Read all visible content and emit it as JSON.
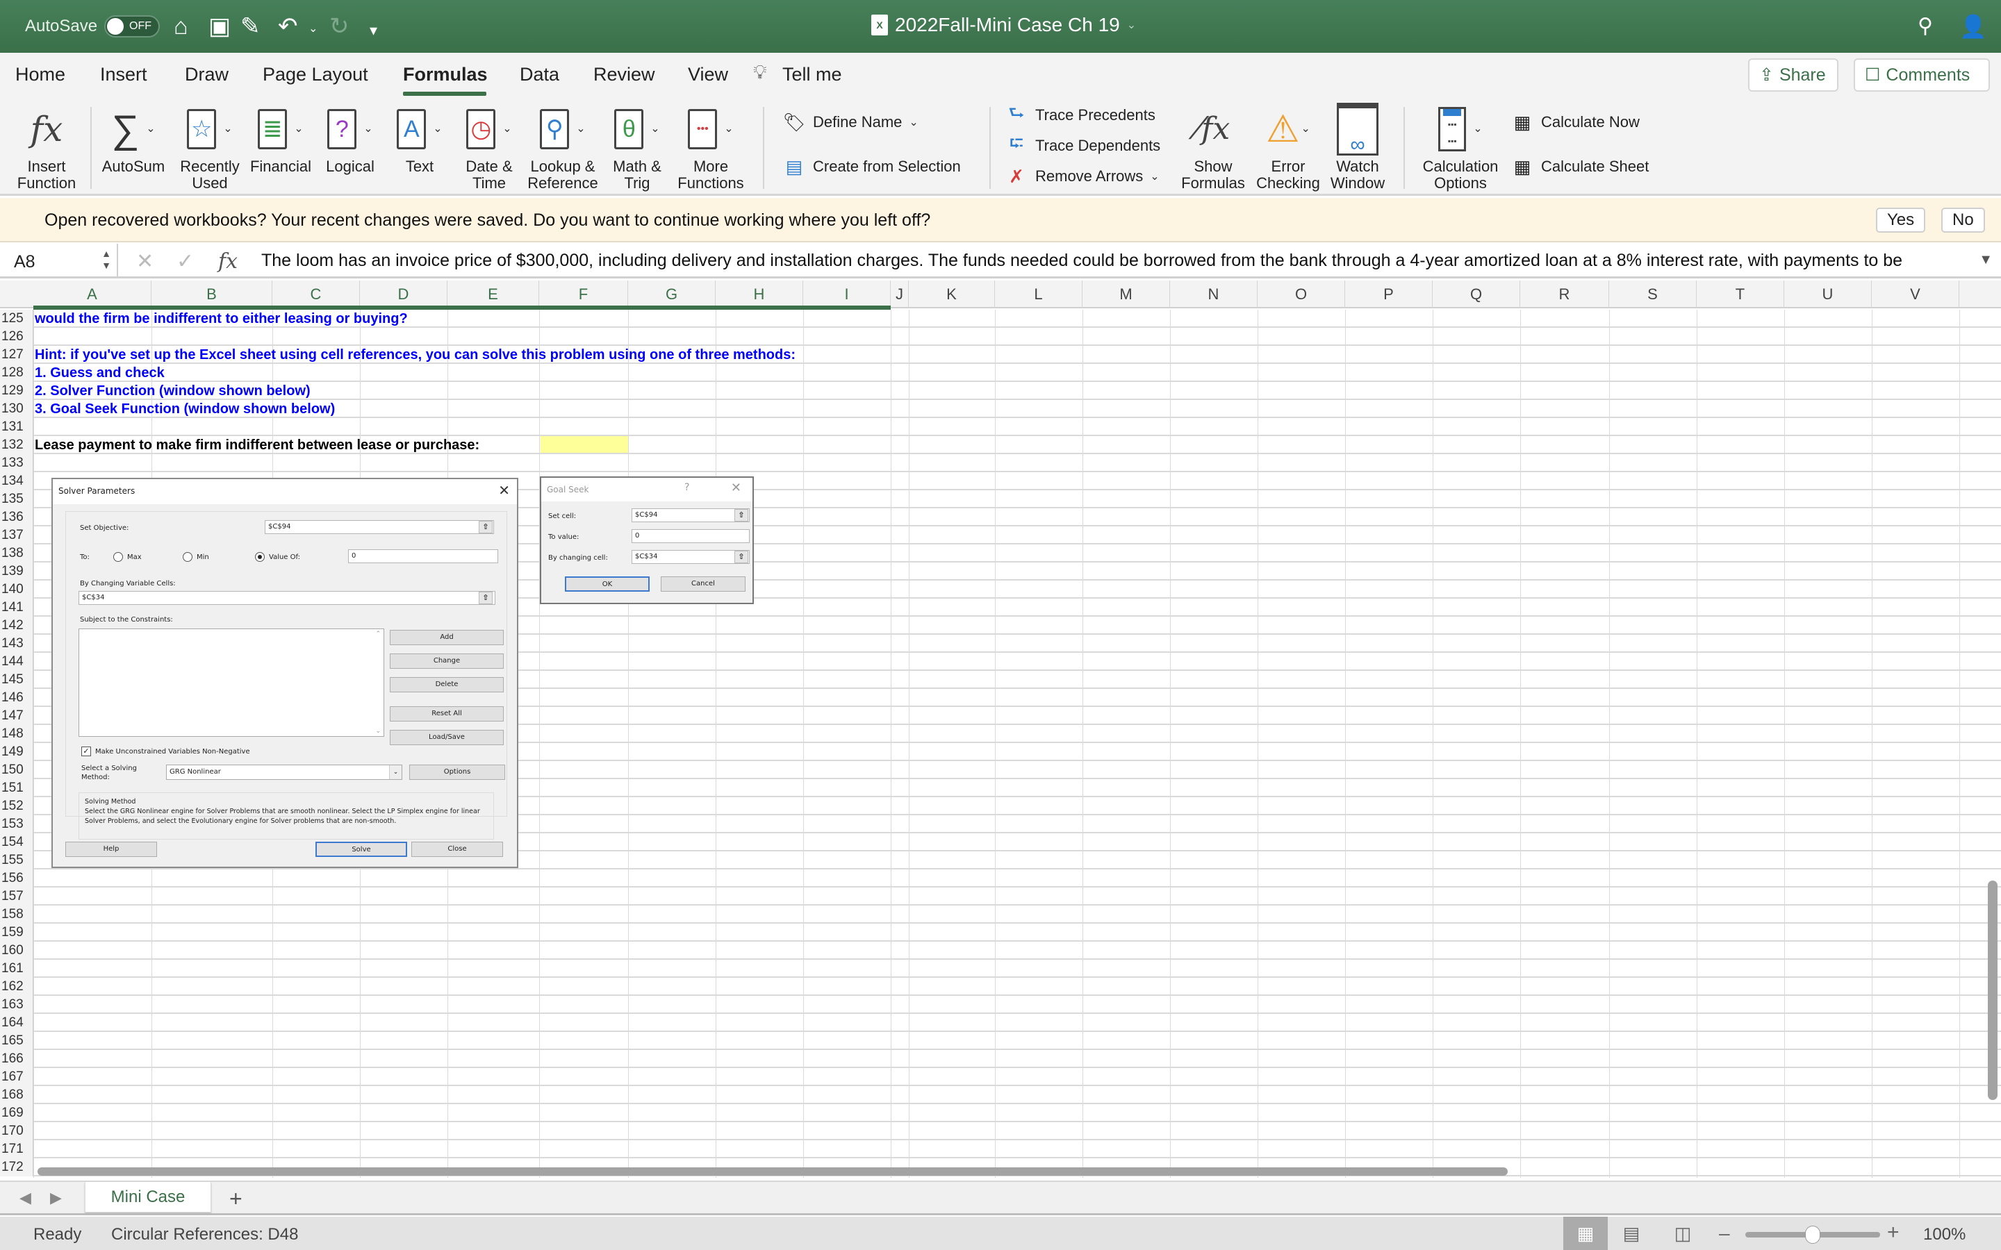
{
  "titlebar": {
    "autosave_label": "AutoSave",
    "autosave_state": "OFF",
    "document_title": "2022Fall-Mini Case Ch 19",
    "quick_icons": [
      "home-icon",
      "save-icon",
      "edit-icon",
      "undo-icon",
      "redo-icon",
      "customize-icon"
    ]
  },
  "tabs": {
    "items": [
      "Home",
      "Insert",
      "Draw",
      "Page Layout",
      "Formulas",
      "Data",
      "Review",
      "View"
    ],
    "active": "Formulas",
    "tell_me": "Tell me",
    "share": "Share",
    "comments": "Comments"
  },
  "ribbon": {
    "insert_function": [
      "Insert",
      "Function"
    ],
    "library": [
      {
        "label": [
          "AutoSum",
          ""
        ],
        "icon": "∑",
        "color": "#333333"
      },
      {
        "label": [
          "Recently",
          "Used"
        ],
        "icon": "☆",
        "color": "#2f7fd1"
      },
      {
        "label": [
          "Financial",
          ""
        ],
        "icon": "≣",
        "color": "#3d9a4a"
      },
      {
        "label": [
          "Logical",
          ""
        ],
        "icon": "?",
        "color": "#9b38c4"
      },
      {
        "label": [
          "Text",
          ""
        ],
        "icon": "A",
        "color": "#2f7fd1"
      },
      {
        "label": [
          "Date &",
          "Time"
        ],
        "icon": "◷",
        "color": "#d93a3a"
      },
      {
        "label": [
          "Lookup &",
          "Reference"
        ],
        "icon": "⚲",
        "color": "#2f7fd1"
      },
      {
        "label": [
          "Math &",
          "Trig"
        ],
        "icon": "θ",
        "color": "#3d9a4a"
      },
      {
        "label": [
          "More",
          "Functions"
        ],
        "icon": "•••",
        "color": "#d93a3a"
      }
    ],
    "define_name": "Define Name",
    "create_from_selection": "Create from Selection",
    "trace_precedents": "Trace Precedents",
    "trace_dependents": "Trace Dependents",
    "remove_arrows": "Remove Arrows",
    "show_formulas": [
      "Show",
      "Formulas"
    ],
    "error_checking": [
      "Error",
      "Checking"
    ],
    "watch_window": [
      "Watch",
      "Window"
    ],
    "calculation_options": [
      "Calculation",
      "Options"
    ],
    "calculate_now": "Calculate Now",
    "calculate_sheet": "Calculate Sheet"
  },
  "notification": {
    "message": "Open recovered workbooks?  Your recent changes were saved. Do you want to continue working where you left off?",
    "yes": "Yes",
    "no": "No"
  },
  "formula_bar": {
    "name_box": "A8",
    "formula": "The loom has an invoice price of $300,000, including delivery and installation charges.  The funds needed could be borrowed from the bank through a 4-year amortized loan at a 8% interest rate, with payments to be"
  },
  "columns": [
    "A",
    "B",
    "C",
    "D",
    "E",
    "F",
    "G",
    "H",
    "I",
    "J",
    "K",
    "L",
    "M",
    "N",
    "O",
    "P",
    "Q",
    "R",
    "S",
    "T",
    "U",
    "V"
  ],
  "rows": {
    "first": 125,
    "last": 172,
    "cells": [
      {
        "row": 125,
        "text": "would the firm be indifferent to either leasing or buying?",
        "style": "blue"
      },
      {
        "row": 127,
        "text": "Hint: if you've set up the Excel sheet using cell references, you can solve this problem using one of three methods:",
        "style": "blue"
      },
      {
        "row": 128,
        "text": "1. Guess and check",
        "style": "blue"
      },
      {
        "row": 129,
        "text": "2. Solver Function (window shown below)",
        "style": "blue"
      },
      {
        "row": 130,
        "text": "3. Goal Seek Function (window shown below)",
        "style": "blue"
      },
      {
        "row": 132,
        "text": "Lease payment to make firm indifferent between lease or purchase:",
        "style": "black"
      }
    ],
    "highlight_cell": "F132"
  },
  "solver": {
    "title": "Solver Parameters",
    "set_objective_label": "Set Objective:",
    "set_objective_value": "$C$94",
    "to_label": "To:",
    "options": [
      "Max",
      "Min",
      "Value Of:"
    ],
    "selected_option": "Value Of:",
    "value_of": "0",
    "changing_label": "By Changing Variable Cells:",
    "changing_value": "$C$34",
    "constraints_label": "Subject to the Constraints:",
    "buttons_side": [
      "Add",
      "Change",
      "Delete",
      "Reset All",
      "Load/Save"
    ],
    "nonneg_label": "Make Unconstrained Variables Non-Negative",
    "nonneg_checked": true,
    "method_label": [
      "Select a Solving",
      "Method:"
    ],
    "method_value": "GRG Nonlinear",
    "options_button": "Options",
    "method_box_title": "Solving Method",
    "method_box_text": "Select the GRG Nonlinear engine for Solver Problems that are smooth nonlinear. Select the LP Simplex engine for linear Solver Problems, and select the Evolutionary engine for Solver problems that are non-smooth.",
    "help": "Help",
    "solve": "Solve",
    "close": "Close"
  },
  "goal_seek": {
    "title": "Goal Seek",
    "help_glyph": "?",
    "set_cell_label": "Set cell:",
    "set_cell_value": "$C$94",
    "to_value_label": "To value:",
    "to_value": "0",
    "changing_label": "By changing cell:",
    "changing_value": "$C$34",
    "ok": "OK",
    "cancel": "Cancel"
  },
  "sheet_tabs": {
    "active": "Mini Case",
    "add": "+"
  },
  "status_bar": {
    "ready": "Ready",
    "circular": "Circular References: D48",
    "zoom": "100%",
    "zoom_fraction": 0.5
  }
}
